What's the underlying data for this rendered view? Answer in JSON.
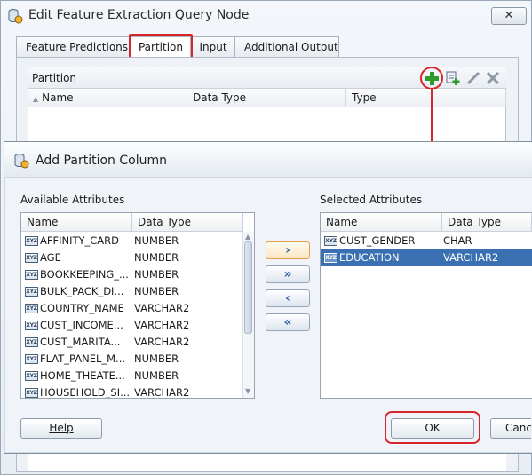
{
  "colors": {
    "highlight": "#d7262b",
    "selection": "#3a70b2",
    "add_icon": "#2e9a2e"
  },
  "back_window": {
    "title": "Edit Feature Extraction Query Node",
    "close_glyph": "✕",
    "tabs": [
      "Feature Predictions",
      "Partition",
      "Input",
      "Additional Output"
    ],
    "partition_label": "Partition",
    "columns": [
      "Name",
      "Data Type",
      "Type"
    ],
    "icons": [
      "add-icon",
      "add-attribute-icon",
      "edit-icon",
      "delete-icon"
    ]
  },
  "dialog": {
    "title": "Add Partition Column",
    "available": {
      "label": "Available Attributes",
      "columns": [
        "Name",
        "Data Type"
      ],
      "rows": [
        {
          "name": "AFFINITY_CARD",
          "type": "NUMBER"
        },
        {
          "name": "AGE",
          "type": "NUMBER"
        },
        {
          "name": "BOOKKEEPING_...",
          "type": "NUMBER"
        },
        {
          "name": "BULK_PACK_DI...",
          "type": "NUMBER"
        },
        {
          "name": "COUNTRY_NAME",
          "type": "VARCHAR2"
        },
        {
          "name": "CUST_INCOME...",
          "type": "VARCHAR2"
        },
        {
          "name": "CUST_MARITA...",
          "type": "VARCHAR2"
        },
        {
          "name": "FLAT_PANEL_M...",
          "type": "NUMBER"
        },
        {
          "name": "HOME_THEATE...",
          "type": "NUMBER"
        },
        {
          "name": "HOUSEHOLD_SI...",
          "type": "VARCHAR2"
        }
      ]
    },
    "selected": {
      "label": "Selected Attributes",
      "columns": [
        "Name",
        "Data Type"
      ],
      "rows": [
        {
          "name": "CUST_GENDER",
          "type": "CHAR"
        },
        {
          "name": "EDUCATION",
          "type": "VARCHAR2"
        }
      ]
    },
    "shuttle": [
      "›",
      "»",
      "‹",
      "«"
    ],
    "buttons": {
      "help": "Help",
      "ok": "OK",
      "cancel": "Cancel"
    }
  }
}
